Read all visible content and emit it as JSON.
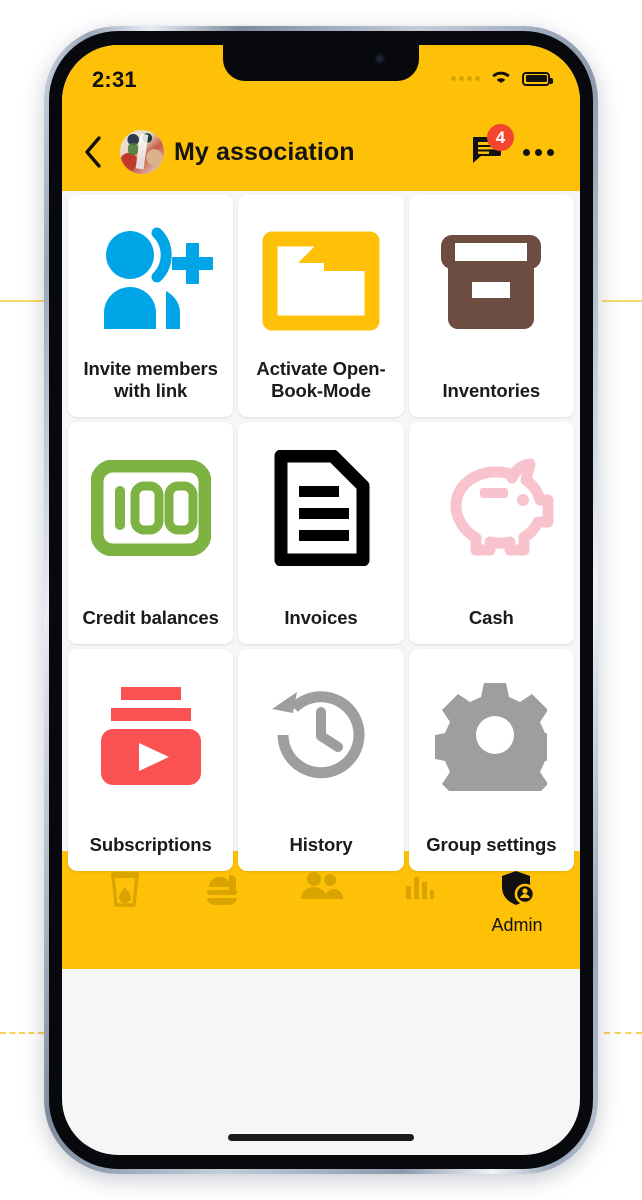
{
  "statusbar": {
    "time": "2:31",
    "signal_icon": "cellular-dots-icon",
    "wifi_icon": "wifi-icon",
    "battery_icon": "battery-full-icon"
  },
  "appbar": {
    "back_icon": "back-chevron-icon",
    "avatar": "group-avatar",
    "title": "My association",
    "chat_icon": "chat-bubble-icon",
    "chat_badge": "4",
    "badge_color": "#F4452F",
    "more_icon": "more-horizontal-icon",
    "background": "#FFC107"
  },
  "grid": {
    "items": [
      {
        "label": "Invite members with link",
        "icon": "person-add-icon",
        "color": "#00A5E8"
      },
      {
        "label": "Activate Open-Book-Mode",
        "icon": "folder-icon",
        "color": "#FFC107"
      },
      {
        "label": "Inventories",
        "icon": "archive-box-icon",
        "color": "#6D4C41"
      },
      {
        "label": "Credit balances",
        "icon": "banknote-100-icon",
        "color": "#7CB342"
      },
      {
        "label": "Invoices",
        "icon": "document-lines-icon",
        "color": "#000000"
      },
      {
        "label": "Cash",
        "icon": "piggy-bank-icon",
        "color": "#F9C3CE"
      },
      {
        "label": "Subscriptions",
        "icon": "subscriptions-play-icon",
        "color": "#FA5252"
      },
      {
        "label": "History",
        "icon": "history-clock-icon",
        "color": "#9E9E9E"
      },
      {
        "label": "Group settings",
        "icon": "gear-icon",
        "color": "#9E9E9E"
      }
    ]
  },
  "tabbar": {
    "background": "#FFC107",
    "tabs": [
      {
        "label": "",
        "icon": "drink-cup-icon",
        "active": false
      },
      {
        "label": "",
        "icon": "food-tray-icon",
        "active": false
      },
      {
        "label": "",
        "icon": "people-icon",
        "active": false
      },
      {
        "label": "",
        "icon": "bar-chart-icon",
        "active": false
      },
      {
        "label": "Admin",
        "icon": "admin-shield-icon",
        "active": true
      }
    ]
  }
}
